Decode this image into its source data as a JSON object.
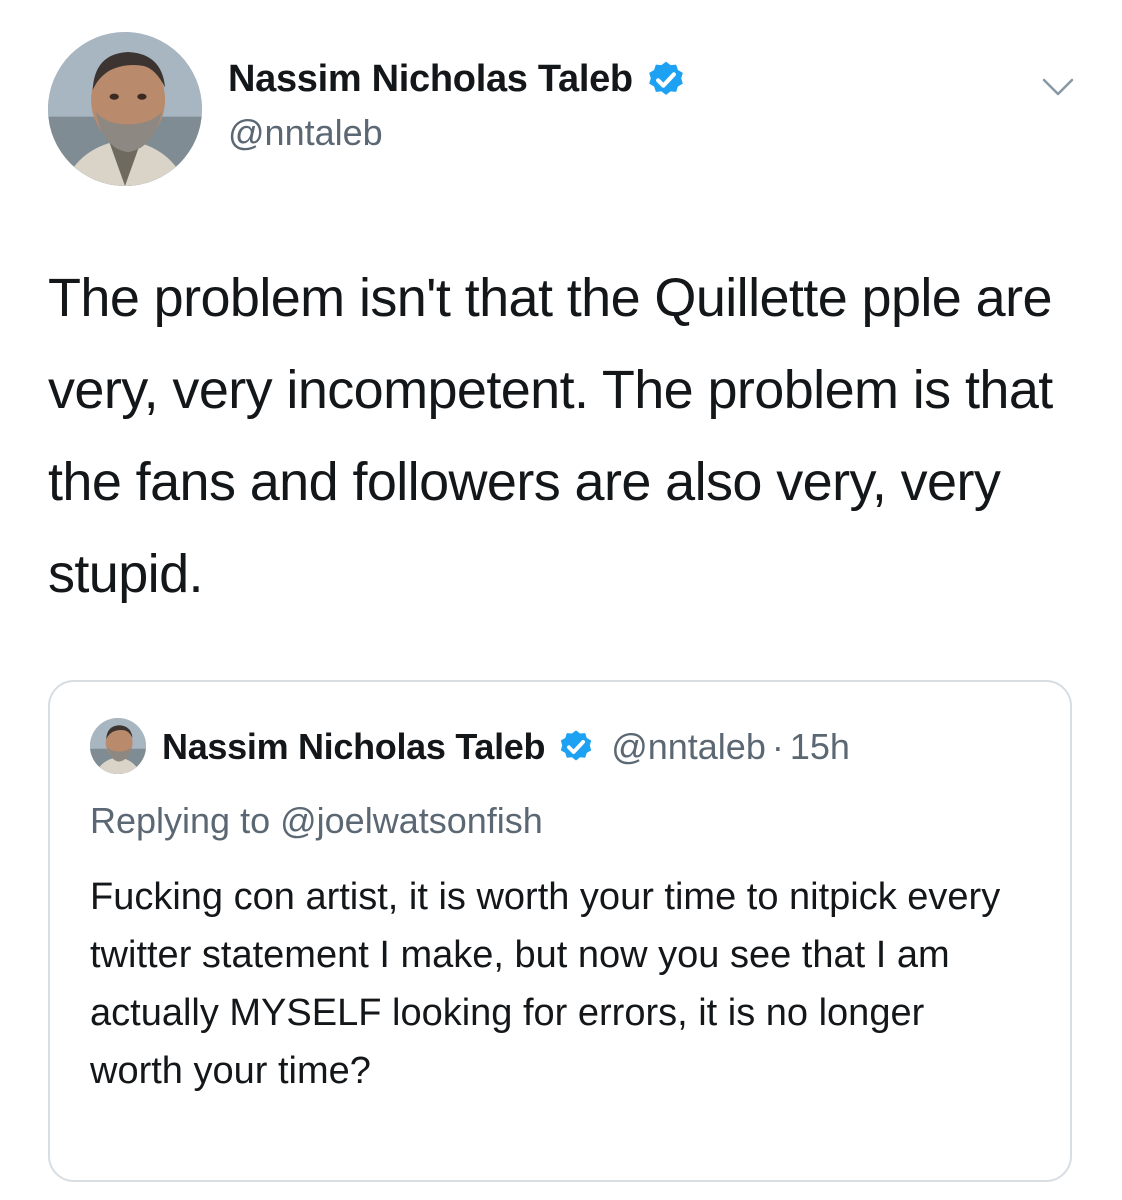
{
  "author": {
    "name": "Nassim Nicholas Taleb",
    "handle": "@nntaleb",
    "verified_color": "#1da1f2",
    "avatar_icon": "profile-photo"
  },
  "tweet": {
    "text": "The problem isn't that the Quillette pple are very, very incompetent. The problem is that the fans and followers are also very, very stupid."
  },
  "menu_icon": "chevron-down-icon",
  "quoted_tweet": {
    "name": "Nassim Nicholas Taleb",
    "handle": "@nntaleb",
    "separator": "·",
    "time": "15h",
    "replying_to": "Replying to @joelwatsonfish",
    "text": "Fucking con artist, it is worth your time to nitpick every twitter statement I make, but now you see that I am actually MYSELF looking for errors, it is no longer worth your time?"
  }
}
